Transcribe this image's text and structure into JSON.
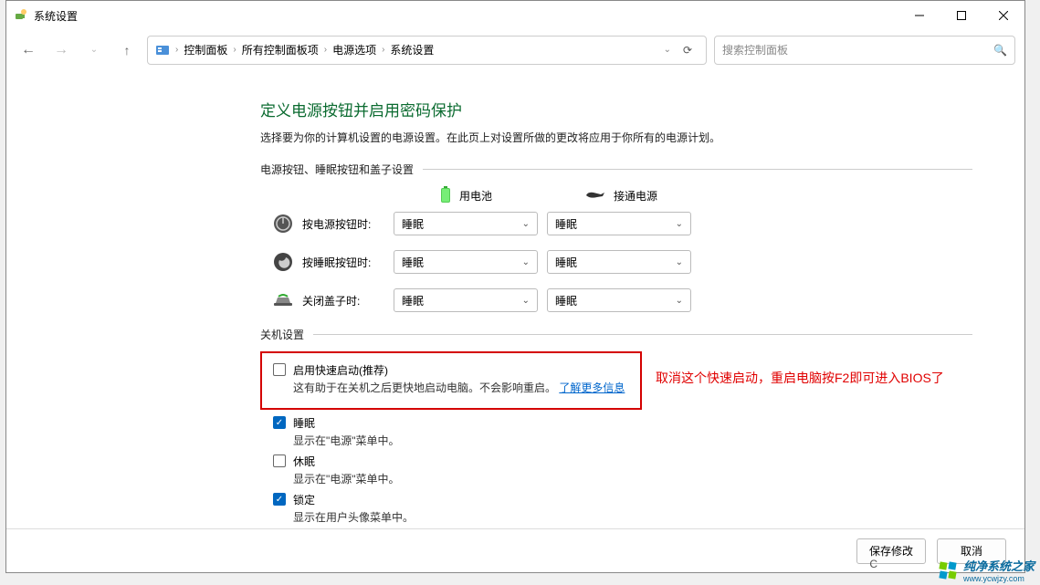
{
  "window": {
    "title": "系统设置",
    "min": "—",
    "max": "▢",
    "close": "✕"
  },
  "breadcrumb": {
    "items": [
      "控制面板",
      "所有控制面板项",
      "电源选项",
      "系统设置"
    ]
  },
  "search": {
    "placeholder": "搜索控制面板"
  },
  "page": {
    "title": "定义电源按钮并启用密码保护",
    "desc": "选择要为你的计算机设置的电源设置。在此页上对设置所做的更改将应用于你所有的电源计划。"
  },
  "sections": {
    "buttons_label": "电源按钮、睡眠按钮和盖子设置",
    "shutdown_label": "关机设置"
  },
  "columns": {
    "battery": "用电池",
    "ac": "接通电源"
  },
  "rows": [
    {
      "label": "按电源按钮时:",
      "battery": "睡眠",
      "ac": "睡眠"
    },
    {
      "label": "按睡眠按钮时:",
      "battery": "睡眠",
      "ac": "睡眠"
    },
    {
      "label": "关闭盖子时:",
      "battery": "睡眠",
      "ac": "睡眠"
    }
  ],
  "shutdown": {
    "fast": {
      "title": "启用快速启动(推荐)",
      "sub": "这有助于在关机之后更快地启动电脑。不会影响重启。",
      "link": "了解更多信息",
      "checked": false
    },
    "sleep": {
      "title": "睡眠",
      "sub": "显示在\"电源\"菜单中。",
      "checked": true
    },
    "hibernate": {
      "title": "休眠",
      "sub": "显示在\"电源\"菜单中。",
      "checked": false
    },
    "lock": {
      "title": "锁定",
      "sub": "显示在用户头像菜单中。",
      "checked": true
    }
  },
  "annotation": "取消这个快速启动，重启电脑按F2即可进入BIOS了",
  "buttons": {
    "save": "保存修改",
    "cancel": "取消"
  },
  "watermark": {
    "text": "纯净系统之家",
    "url": "www.ycwjzy.com"
  },
  "c_indicator": "C"
}
